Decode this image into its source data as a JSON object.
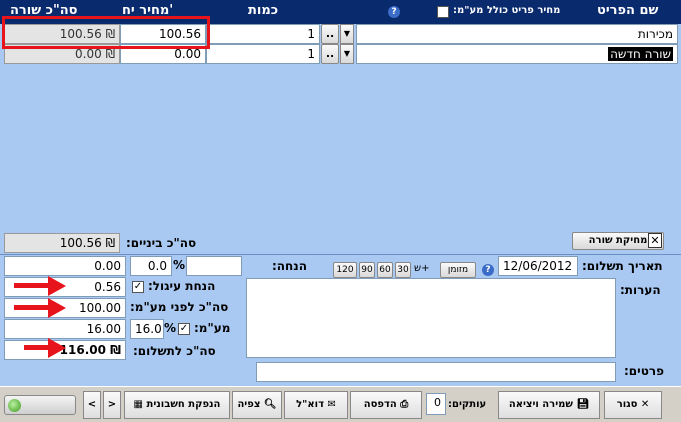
{
  "header": {
    "item_name": "שם הפריט",
    "price_incl_vat": "מחיר פריט כולל מע\"מ:",
    "quantity": "כמות",
    "unit_price": "מחיר יח'",
    "line_total": "סה\"כ שורה",
    "help": "?"
  },
  "rows": [
    {
      "name": "מכירות",
      "qty": "1",
      "unit_price": "100.56",
      "total": "100.56 ₪",
      "more": ".."
    },
    {
      "name": "שורה חדשה",
      "qty": "1",
      "unit_price": "0.00",
      "total": "0.00 ₪",
      "more": ".."
    }
  ],
  "delete_line": "מחיקת שורה",
  "subtotal": {
    "label": "סה\"כ ביניים:",
    "value": "100.56 ₪"
  },
  "discount": {
    "label": "הנחה:",
    "value": "",
    "percent": "0.0",
    "pct_sign": "%",
    "amount": "0.00"
  },
  "payment": {
    "label": "תאריך תשלום:",
    "date": "12/06/2012",
    "cash": "מזומן",
    "plus_label": "ש+",
    "days": [
      "30",
      "60",
      "90",
      "120"
    ]
  },
  "rounding": {
    "label": "הנחת עיגול:",
    "value": "0.56"
  },
  "before_vat": {
    "label": "סה\"כ לפני מע\"מ:",
    "value": "100.00"
  },
  "vat": {
    "label": "מע\"מ:",
    "percent": "16.0",
    "pct_sign": "%",
    "value": "16.00"
  },
  "total_payment": {
    "label": "סה\"כ לתשלום:",
    "value": "116.00 ₪"
  },
  "notes": {
    "label": "הערות:",
    "value": ""
  },
  "details": {
    "label": "פרטים:",
    "value": ""
  },
  "toolbar": {
    "close": "סגור",
    "save_exit": "שמירה ויציאה",
    "copies_label": "עותקים:",
    "copies_value": "0",
    "print": "הדפסה",
    "email": "דוא\"ל",
    "preview": "צפיה",
    "accounting": "הנפקת חשבונית",
    "next": ">",
    "prev": "<"
  },
  "colors": {
    "header": "#0a2a6e",
    "background": "#a9c9f2",
    "annotation": "#e8141b"
  }
}
